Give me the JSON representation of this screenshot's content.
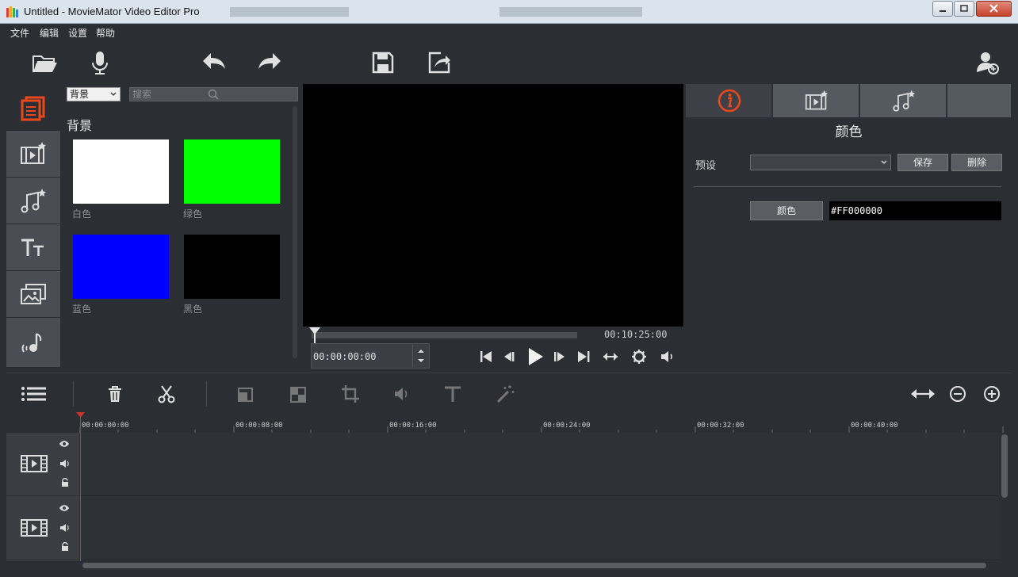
{
  "window": {
    "title": "Untitled - MovieMator Video Editor Pro",
    "buttons": [
      "minimize",
      "maximize",
      "close"
    ]
  },
  "menu": {
    "items": [
      "文件",
      "编辑",
      "设置",
      "帮助"
    ]
  },
  "toolbar": {
    "icons": [
      "folder-open-icon",
      "microphone-icon",
      "undo-icon",
      "redo-icon",
      "save-icon",
      "export-icon",
      "account-icon"
    ]
  },
  "left_panel": {
    "active": "media",
    "icons": [
      "media-library-icon",
      "video-effects-icon",
      "audio-effects-icon",
      "text-icon",
      "image-overlay-icon",
      "audio-transition-icon"
    ]
  },
  "library": {
    "category_select": "背景",
    "search_placeholder": "搜索",
    "heading": "背景",
    "items": [
      {
        "label": "白色",
        "color": "#FFFFFF"
      },
      {
        "label": "绿色",
        "color": "#00FF00"
      },
      {
        "label": "蓝色",
        "color": "#0000FF"
      },
      {
        "label": "黑色",
        "color": "#000000"
      }
    ]
  },
  "player": {
    "duration": "00:10:25:00",
    "timecode": "00:00:00:00",
    "controls": [
      "skip-start-icon",
      "prev-frame-icon",
      "play-icon",
      "next-frame-icon",
      "skip-end-icon",
      "fit-icon",
      "settings-icon",
      "volume-icon"
    ]
  },
  "inspector": {
    "tabs": [
      "info-icon",
      "video-filter-icon",
      "audio-filter-icon",
      ""
    ],
    "active_tab": 0,
    "title": "颜色",
    "preset_label": "预设",
    "preset_value": "",
    "save_label": "保存",
    "delete_label": "删除",
    "color_button": "颜色",
    "color_value": "#FF000000",
    "accent": "#e8481b"
  },
  "timeline": {
    "tools": [
      "menu-icon",
      "delete-icon",
      "cut-icon",
      "copy-icon",
      "paste-icon",
      "crop-icon",
      "audio-icon",
      "text-tool-icon",
      "magic-icon"
    ],
    "zoom_tools": [
      "fit-timeline-icon",
      "zoom-out-icon",
      "zoom-in-icon"
    ],
    "ruler": [
      "00:00:00:00",
      "00:00:08:00",
      "00:00:16:00",
      "00:00:24:00",
      "00:00:32:00",
      "00:00:40:00"
    ]
  }
}
